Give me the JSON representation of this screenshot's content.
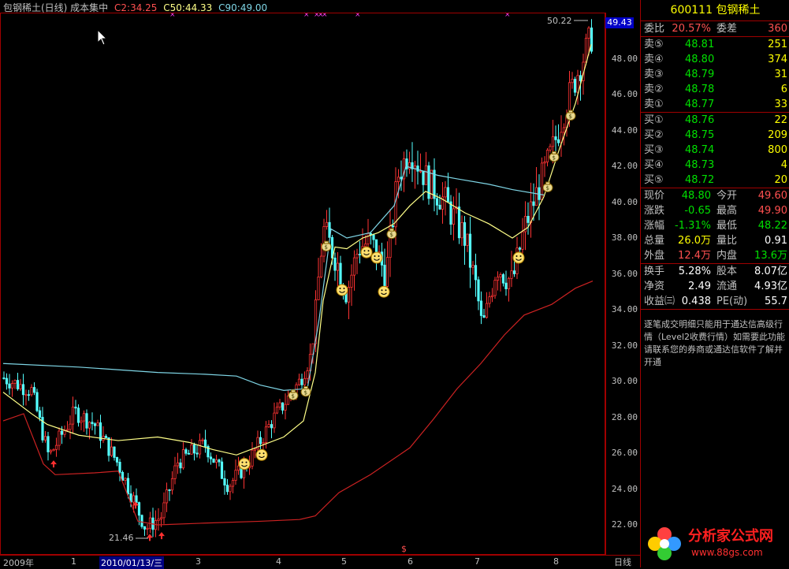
{
  "header": {
    "title": "包钢稀土(日线) 成本集中",
    "c2": "C2:34.25",
    "c50": "C50:44.33",
    "c90": "C90:49.00"
  },
  "price_tag": "49.43",
  "high_label": "50.22",
  "low_label": "21.46",
  "y_ticks": [
    "48.00",
    "46.00",
    "44.00",
    "42.00",
    "40.00",
    "38.00",
    "36.00",
    "34.00",
    "32.00",
    "30.00",
    "28.00",
    "26.00",
    "24.00",
    "22.00"
  ],
  "x_labels": [
    "2009年",
    "1",
    "2010/01/13/三",
    "3",
    "4",
    "5",
    "6",
    "7",
    "8"
  ],
  "x_mode": "日线",
  "dollar_marker": "$",
  "colors": {
    "up": "#ff3333",
    "down": "#54ffff",
    "yellow_line": "#ffff88",
    "cyan_line": "#7fd6e6",
    "red_line": "#cc2222",
    "frame": "#a00000"
  },
  "panel": {
    "code": "600111",
    "name": "包钢稀土",
    "wb_label": "委比",
    "wb_value": "20.57%",
    "wc_label": "委差",
    "wc_value": "360",
    "asks": [
      {
        "label": "卖⑤",
        "price": "48.81",
        "vol": "251"
      },
      {
        "label": "卖④",
        "price": "48.80",
        "vol": "374"
      },
      {
        "label": "卖③",
        "price": "48.79",
        "vol": "31"
      },
      {
        "label": "卖②",
        "price": "48.78",
        "vol": "6"
      },
      {
        "label": "卖①",
        "price": "48.77",
        "vol": "33"
      }
    ],
    "bids": [
      {
        "label": "买①",
        "price": "48.76",
        "vol": "22"
      },
      {
        "label": "买②",
        "price": "48.75",
        "vol": "209"
      },
      {
        "label": "买③",
        "price": "48.74",
        "vol": "800"
      },
      {
        "label": "买④",
        "price": "48.73",
        "vol": "4"
      },
      {
        "label": "买⑤",
        "price": "48.72",
        "vol": "20"
      }
    ],
    "quote": [
      {
        "a": "现价",
        "b": "48.80",
        "c": "今开",
        "d": "49.60",
        "bc": "green",
        "dc": "red"
      },
      {
        "a": "涨跌",
        "b": "-0.65",
        "c": "最高",
        "d": "49.90",
        "bc": "green",
        "dc": "red"
      },
      {
        "a": "涨幅",
        "b": "-1.31%",
        "c": "最低",
        "d": "48.22",
        "bc": "green",
        "dc": "green"
      },
      {
        "a": "总量",
        "b": "26.0万",
        "c": "量比",
        "d": "0.91",
        "bc": "yel",
        "dc": "white"
      },
      {
        "a": "外盘",
        "b": "12.4万",
        "c": "内盘",
        "d": "13.6万",
        "bc": "red",
        "dc": "green"
      }
    ],
    "fin": [
      {
        "a": "换手",
        "b": "5.28%",
        "c": "股本",
        "d": "8.07亿"
      },
      {
        "a": "净资",
        "b": "2.49",
        "c": "流通",
        "d": "4.93亿"
      },
      {
        "a": "收益㈢",
        "b": "0.438",
        "c": "PE(动)",
        "d": "55.7"
      }
    ],
    "note": "逐笔成交明细只能用于通达信高级行情（Level2收费行情）如需要此功能请联系您的券商或通达信软件了解并开通",
    "logo_text": "分析家公式网",
    "logo_url": "www.88gs.com"
  }
}
